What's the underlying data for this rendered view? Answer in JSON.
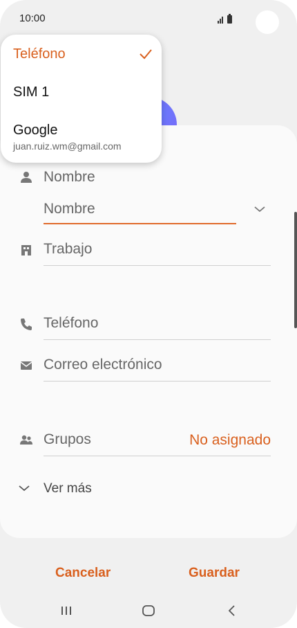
{
  "status_bar": {
    "time": "10:00"
  },
  "form": {
    "name_section_label": "Nombre",
    "name_field_placeholder": "Nombre",
    "work_placeholder": "Trabajo",
    "phone_placeholder": "Teléfono",
    "email_placeholder": "Correo electrónico",
    "groups_label": "Grupos",
    "groups_value": "No asignado",
    "see_more": "Ver más"
  },
  "storage_dropdown": {
    "items": [
      {
        "label": "Teléfono",
        "selected": true
      },
      {
        "label": "SIM 1"
      },
      {
        "label": "Google",
        "sublabel": "juan.ruiz.wm@gmail.com"
      }
    ]
  },
  "actions": {
    "cancel": "Cancelar",
    "save": "Guardar"
  },
  "icons": {
    "person": "person-icon",
    "work": "building-icon",
    "phone": "phone-icon",
    "email": "envelope-icon",
    "groups": "people-icon",
    "chevron": "chevron-down-icon",
    "check": "check-icon",
    "nav_recent": "recent-apps-icon",
    "nav_home": "home-icon",
    "nav_back": "back-icon"
  },
  "colors": {
    "accent": "#d9601e",
    "background": "#f0f0f0",
    "card": "#fafafa"
  }
}
